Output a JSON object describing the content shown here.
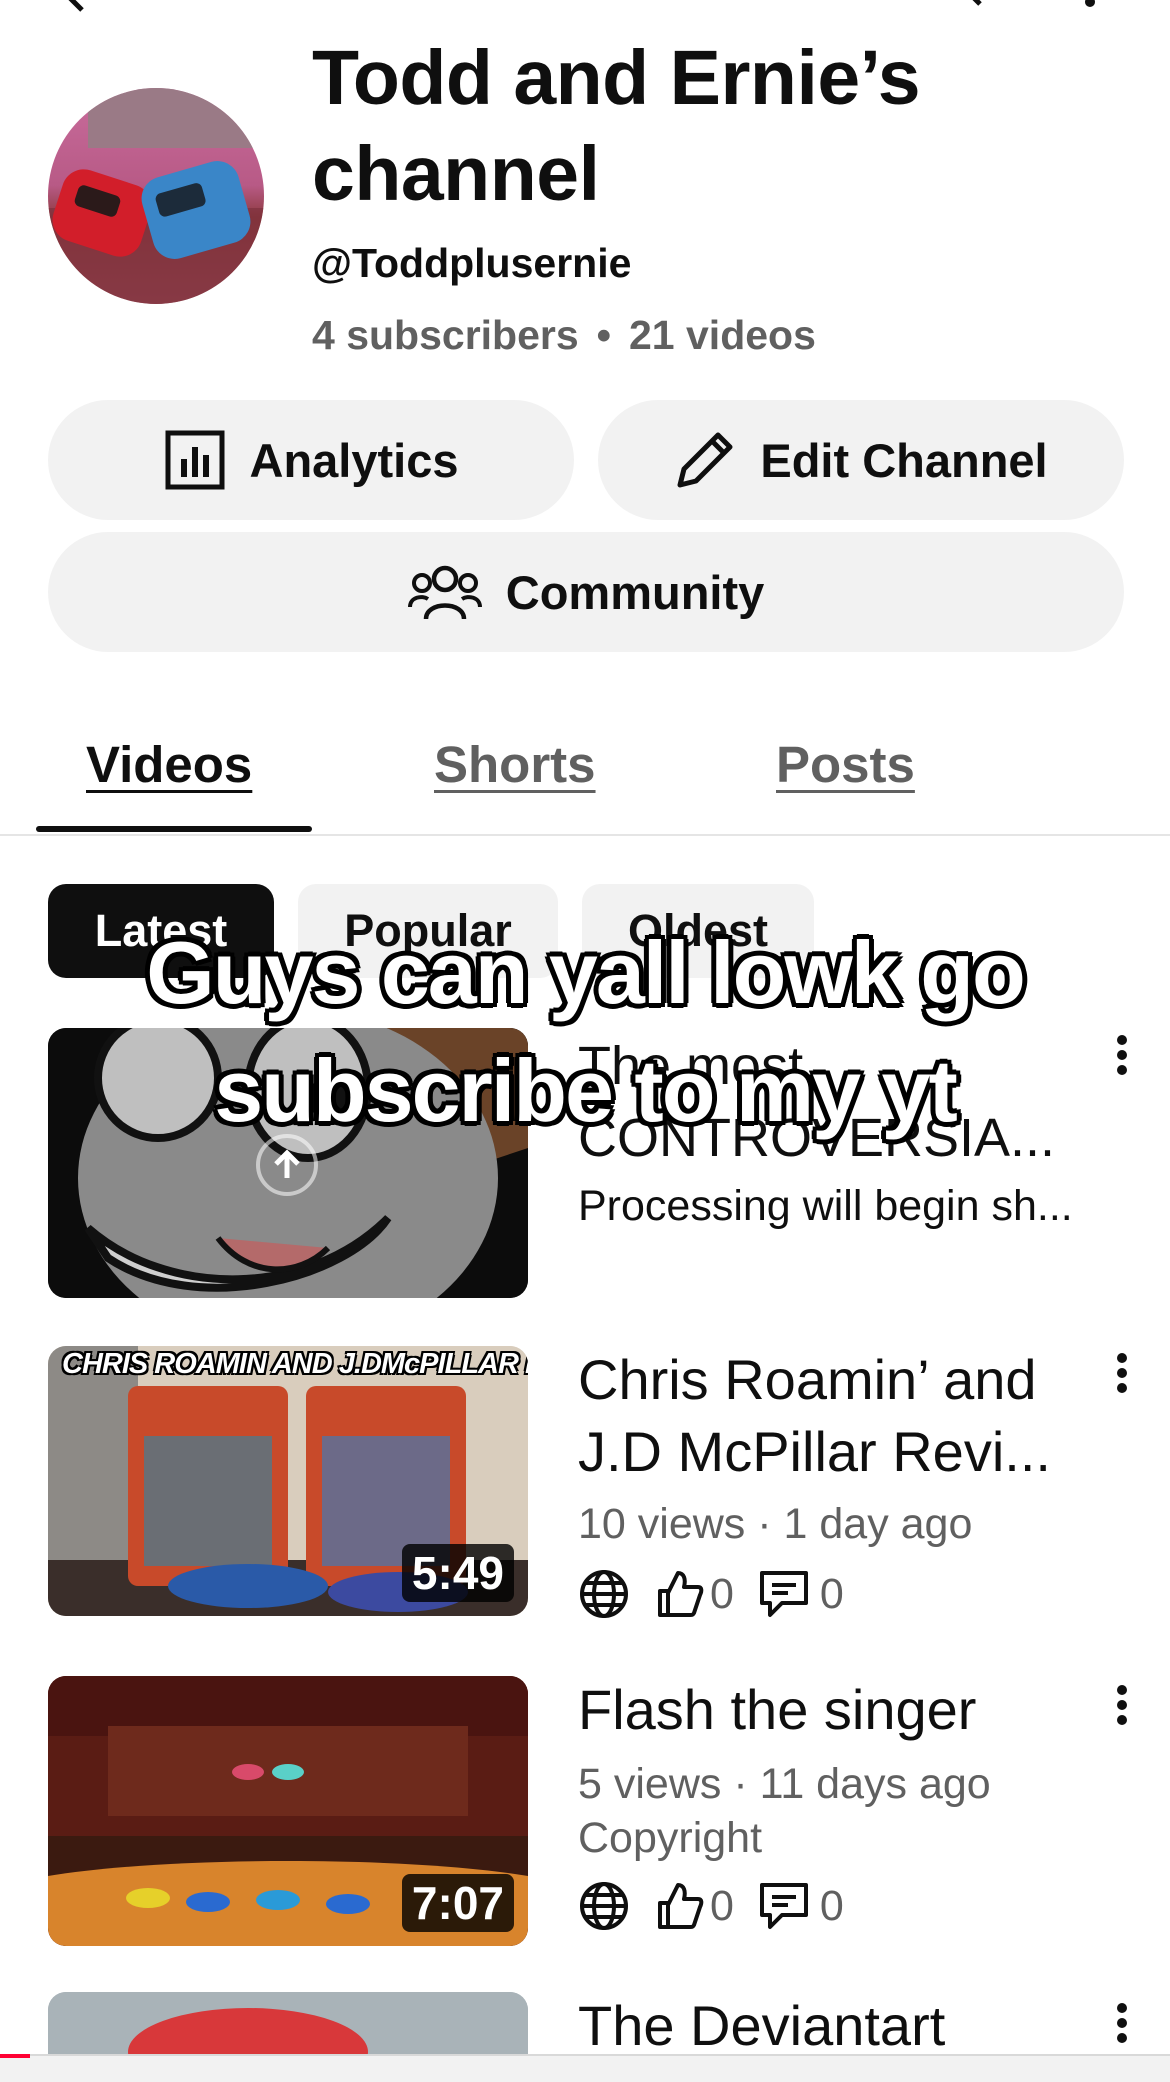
{
  "channel": {
    "title": "Todd and Ernie’s channel",
    "handle": "@Toddplusernie",
    "subscribers": "4 subscribers",
    "videos_count": "21 videos",
    "separator": "•"
  },
  "actions": {
    "analytics_label": "Analytics",
    "edit_label": "Edit Channel",
    "community_label": "Community"
  },
  "tabs": [
    {
      "label": "Videos",
      "active": true
    },
    {
      "label": "Shorts",
      "active": false
    },
    {
      "label": "Posts",
      "active": false
    }
  ],
  "chips": [
    {
      "label": "Latest",
      "active": true
    },
    {
      "label": "Popular",
      "active": false
    },
    {
      "label": "Oldest",
      "active": false
    }
  ],
  "overlay": {
    "line1": "Guys can yall lowk go",
    "line2": "subscribe to my yt"
  },
  "videos": [
    {
      "title": "The most CONTROVERSIA...",
      "status": "Processing will begin sh..."
    },
    {
      "thumb_text": "CHRIS ROAMIN AND J.DMcPILLAR REVIEW",
      "duration": "5:49",
      "title": "Chris Roamin’ and J.D McPillar Revi...",
      "meta": "10 views · 1 day ago",
      "likes": "0",
      "comments": "0"
    },
    {
      "duration": "7:07",
      "title": "Flash the singer",
      "meta": "5 views · 11 days ago",
      "note": "Copyright",
      "likes": "0",
      "comments": "0"
    },
    {
      "title": "The Deviantart"
    }
  ],
  "icons": {
    "analytics": "bar-chart-icon",
    "edit": "pencil-icon",
    "community": "people-icon",
    "visibility": "globe-icon",
    "likes": "thumbs-up-icon",
    "comments": "comment-icon",
    "more": "kebab-icon",
    "upload": "upload-arrow-icon"
  },
  "colors": {
    "accent_red": "#ff0033",
    "chip_active": "#0f0f0f",
    "pill_bg": "#f2f2f2",
    "secondary_text": "#606060"
  }
}
